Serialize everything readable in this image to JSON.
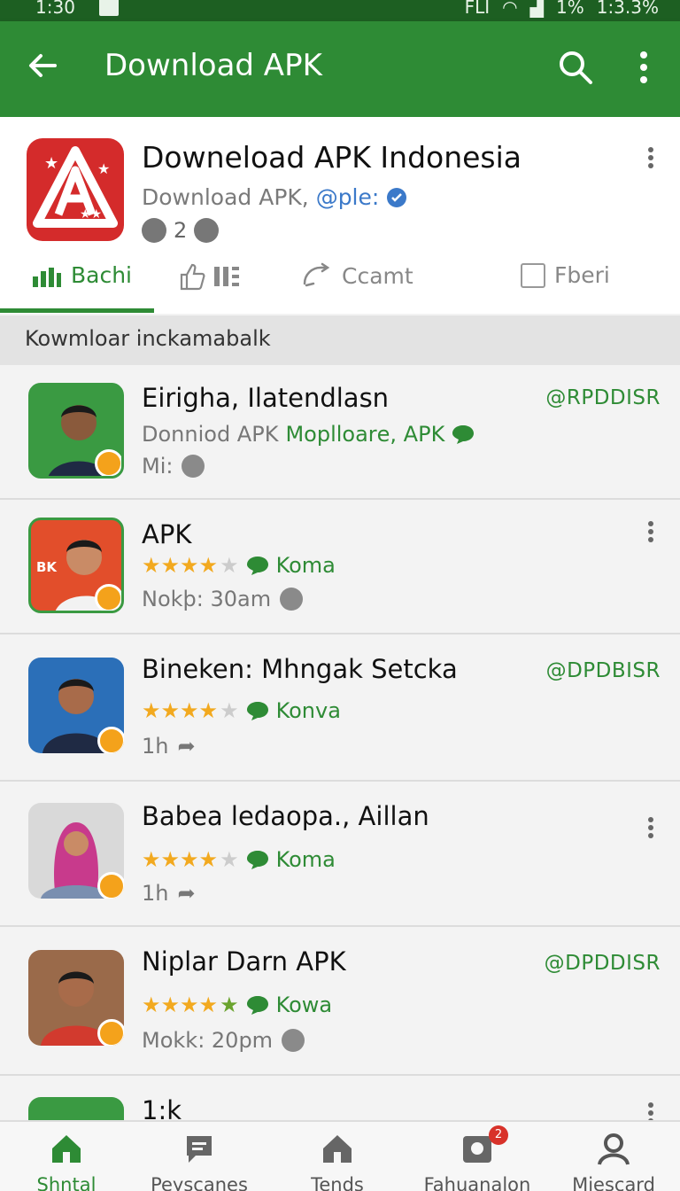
{
  "status_bar": {
    "time": "1:30",
    "right_text_1": "FLI",
    "battery_pct": "1%",
    "clock": "1:3.3%"
  },
  "appbar": {
    "title": "Download APK"
  },
  "header": {
    "title": "Downeload APK Indonesia",
    "subtitle_plain": "Download APK, ",
    "subtitle_link": "@ple:",
    "meta_count": "2"
  },
  "tabs": [
    {
      "label": "Bachi",
      "active": true
    },
    {
      "label": ""
    },
    {
      "label": "Ccamt"
    },
    {
      "label": "Fberi"
    }
  ],
  "section_title": "Kowmloar inckamabalk",
  "items": [
    {
      "name": "Eirigha, Ilatendlasn",
      "line2_plain": "Donniod APK ",
      "line2_green": "Mopllоarе, APK",
      "line3": "Mi:",
      "tag": "@RPDDISR",
      "avatar_bg": "#3a9a42"
    },
    {
      "name": "APK",
      "rating": 4,
      "chat_label": "Koma",
      "line3": "Nokþ: 30am",
      "avatar_bg": "#e24e2b",
      "avatar_text": "BK"
    },
    {
      "name": "Bineken: Mhngak Setcka",
      "rating": 4,
      "chat_label": "Konva",
      "line3": "1h",
      "tag": "@DPDBISR",
      "avatar_bg": "#2b6fb8"
    },
    {
      "name": "Babea ledaopa., Aillan",
      "rating": 4,
      "chat_label": "Koma",
      "line3": "1h",
      "avatar_bg": "#d9d9d9"
    },
    {
      "name": "Niplar Darn APK",
      "rating": 5,
      "chat_label": "Kowa",
      "line3": "Mokk: 20pm",
      "tag": "@DPDDISR",
      "avatar_bg": "#b8332b"
    },
    {
      "name": "1:k",
      "avatar_bg": "#3a9a42"
    }
  ],
  "bottom_nav": [
    {
      "label": "Shntal",
      "active": true
    },
    {
      "label": "Peyscanes"
    },
    {
      "label": "Tends"
    },
    {
      "label": "Fahuanalon",
      "badge": "2"
    },
    {
      "label": "Miescard"
    }
  ],
  "colors": {
    "primary": "#2e8b35",
    "status_bar": "#1d5f22",
    "link": "#3b79c9",
    "badge": "#f4a21b",
    "star": "#f2a91f"
  }
}
